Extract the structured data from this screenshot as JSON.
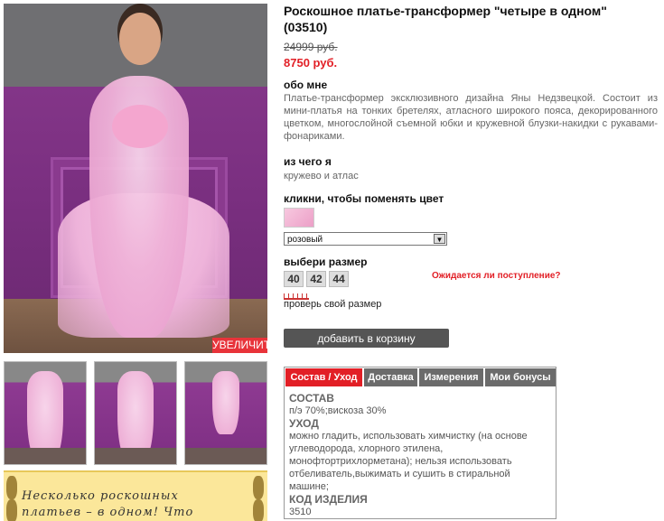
{
  "product": {
    "title": "Роскошное платье-трансформер \"четыре в одном\" (03510)",
    "old_price": "24999 руб.",
    "new_price": "8750 руб.",
    "about_label": "обо мне",
    "description": "Платье-трансформер эксклюзивного дизайна Яны Недзвецкой. Состоит из мини-платья на тонких бретелях, атласного широкого пояса, декорированного цветком, многослойной съемной юбки и кружевной блузки-накидки с рукавами-фонариками.",
    "material_label": "из чего я",
    "material": "кружево и атлас",
    "color_label": "кликни, чтобы поменять цвет",
    "color_selected": "розовый",
    "size_label": "выбери размер",
    "sizes": [
      "40",
      "42",
      "44"
    ],
    "availability_link": "Ожидается ли поступление?",
    "check_size_link": "проверь свой размер",
    "add_to_cart": "добавить в корзину"
  },
  "gallery": {
    "enlarge_label": "УВЕЛИЧИТЬ",
    "promo_text_line1": "Несколько роскошных",
    "promo_text_line2": "платьев – в одном! Что"
  },
  "tabs": {
    "items": [
      "Состав / Уход",
      "Доставка",
      "Измерения",
      "Мои бонусы"
    ],
    "active": "Состав / Уход",
    "content": {
      "composition_title": "СОСТАВ",
      "composition": "п/э 70%;вискоза 30%",
      "care_title": "УХОД",
      "care": "можно гладить, использовать химчистку (на основе углеводорода, хлорного этилена, монофтортрихлорметана); нельзя использовать отбеливатель,выжимать и сушить в стиральной машине;",
      "code_title": "КОД ИЗДЕЛИЯ",
      "code": "3510"
    }
  },
  "colors": {
    "accent_red": "#e21f26",
    "button_gray": "#555555"
  }
}
